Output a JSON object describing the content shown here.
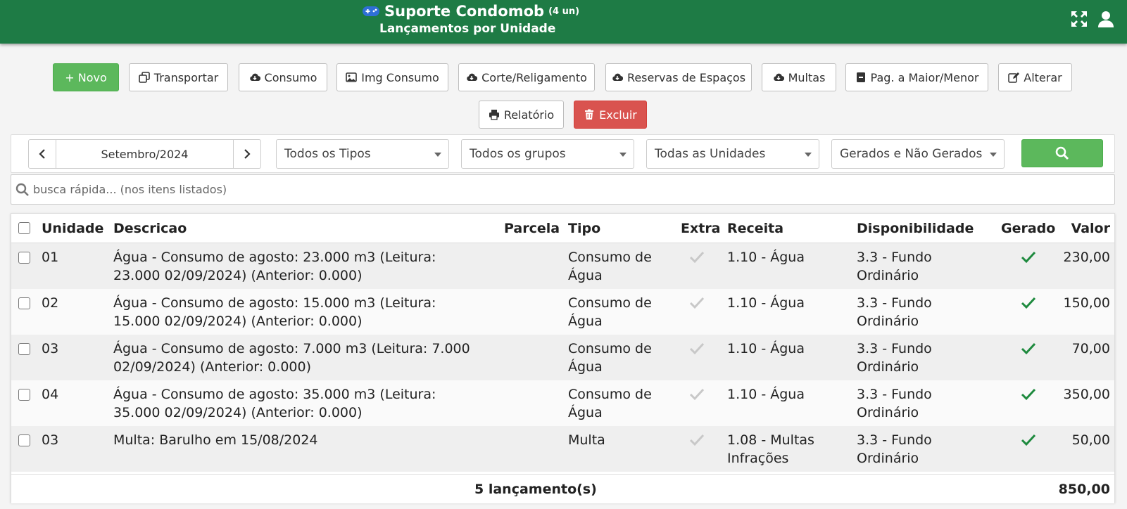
{
  "header": {
    "app_name": "Suporte Condomob",
    "unit_count": "(4 un)",
    "subtitle": "Lançamentos por Unidade"
  },
  "toolbar": {
    "novo": "+ Novo",
    "transportar": "Transportar",
    "consumo": "Consumo",
    "img_consumo": "Img Consumo",
    "corte": "Corte/Religamento",
    "reservas": "Reservas de Espaços",
    "multas": "Multas",
    "pag": "Pag. a Maior/Menor",
    "alterar": "Alterar",
    "relatorio": "Relatório",
    "excluir": "Excluir"
  },
  "filters": {
    "month": "Setembro/2024",
    "tipos": "Todos os Tipos",
    "grupos": "Todos os grupos",
    "unidades": "Todas as Unidades",
    "gerados": "Gerados e Não Gerados"
  },
  "search": {
    "placeholder": "busca rápida... (nos itens listados)"
  },
  "table": {
    "columns": {
      "unidade": "Unidade",
      "descricao": "Descricao",
      "parcela": "Parcela",
      "tipo": "Tipo",
      "extra": "Extra",
      "receita": "Receita",
      "disponibilidade": "Disponibilidade",
      "gerado": "Gerado",
      "valor": "Valor"
    },
    "rows": [
      {
        "unidade": "01",
        "descricao_l1": "Água - Consumo de agosto: 23.000 m3 (Leitura:",
        "descricao_l2": "23.000 02/09/2024) (Anterior: 0.000)",
        "tipo_l1": "Consumo de",
        "tipo_l2": "Água",
        "receita_l1": "1.10 - Água",
        "receita_l2": "",
        "disp_l1": "3.3 - Fundo",
        "disp_l2": "Ordinário",
        "extra": false,
        "gerado": true,
        "valor": "230,00"
      },
      {
        "unidade": "02",
        "descricao_l1": "Água - Consumo de agosto: 15.000 m3 (Leitura:",
        "descricao_l2": "15.000 02/09/2024) (Anterior: 0.000)",
        "tipo_l1": "Consumo de",
        "tipo_l2": "Água",
        "receita_l1": "1.10 - Água",
        "receita_l2": "",
        "disp_l1": "3.3 - Fundo",
        "disp_l2": "Ordinário",
        "extra": false,
        "gerado": true,
        "valor": "150,00"
      },
      {
        "unidade": "03",
        "descricao_l1": "Água - Consumo de agosto: 7.000 m3 (Leitura: 7.000",
        "descricao_l2": "02/09/2024) (Anterior: 0.000)",
        "tipo_l1": "Consumo de",
        "tipo_l2": "Água",
        "receita_l1": "1.10 - Água",
        "receita_l2": "",
        "disp_l1": "3.3 - Fundo",
        "disp_l2": "Ordinário",
        "extra": false,
        "gerado": true,
        "valor": "70,00"
      },
      {
        "unidade": "04",
        "descricao_l1": "Água - Consumo de agosto: 35.000 m3 (Leitura:",
        "descricao_l2": "35.000 02/09/2024) (Anterior: 0.000)",
        "tipo_l1": "Consumo de",
        "tipo_l2": "Água",
        "receita_l1": "1.10 - Água",
        "receita_l2": "",
        "disp_l1": "3.3 - Fundo",
        "disp_l2": "Ordinário",
        "extra": false,
        "gerado": true,
        "valor": "350,00"
      },
      {
        "unidade": "03",
        "descricao_l1": "Multa: Barulho em 15/08/2024",
        "descricao_l2": "",
        "tipo_l1": "Multa",
        "tipo_l2": "",
        "receita_l1": "1.08 - Multas",
        "receita_l2": "Infrações",
        "disp_l1": "3.3 - Fundo",
        "disp_l2": "Ordinário",
        "extra": false,
        "gerado": true,
        "valor": "50,00"
      }
    ],
    "footer": {
      "count": "5 lançamento(s)",
      "total": "850,00"
    }
  },
  "colors": {
    "header_bg": "#1e7b45",
    "green_button": "#5cb85c",
    "red_button": "#d9534f",
    "check_green": "#1e8a3e",
    "check_gray": "#c8c8c8",
    "row_alt": "#efefef"
  },
  "icons": {
    "header": [
      "gamepad-icon",
      "expand-icon",
      "user-icon"
    ],
    "search": "search-icon"
  }
}
